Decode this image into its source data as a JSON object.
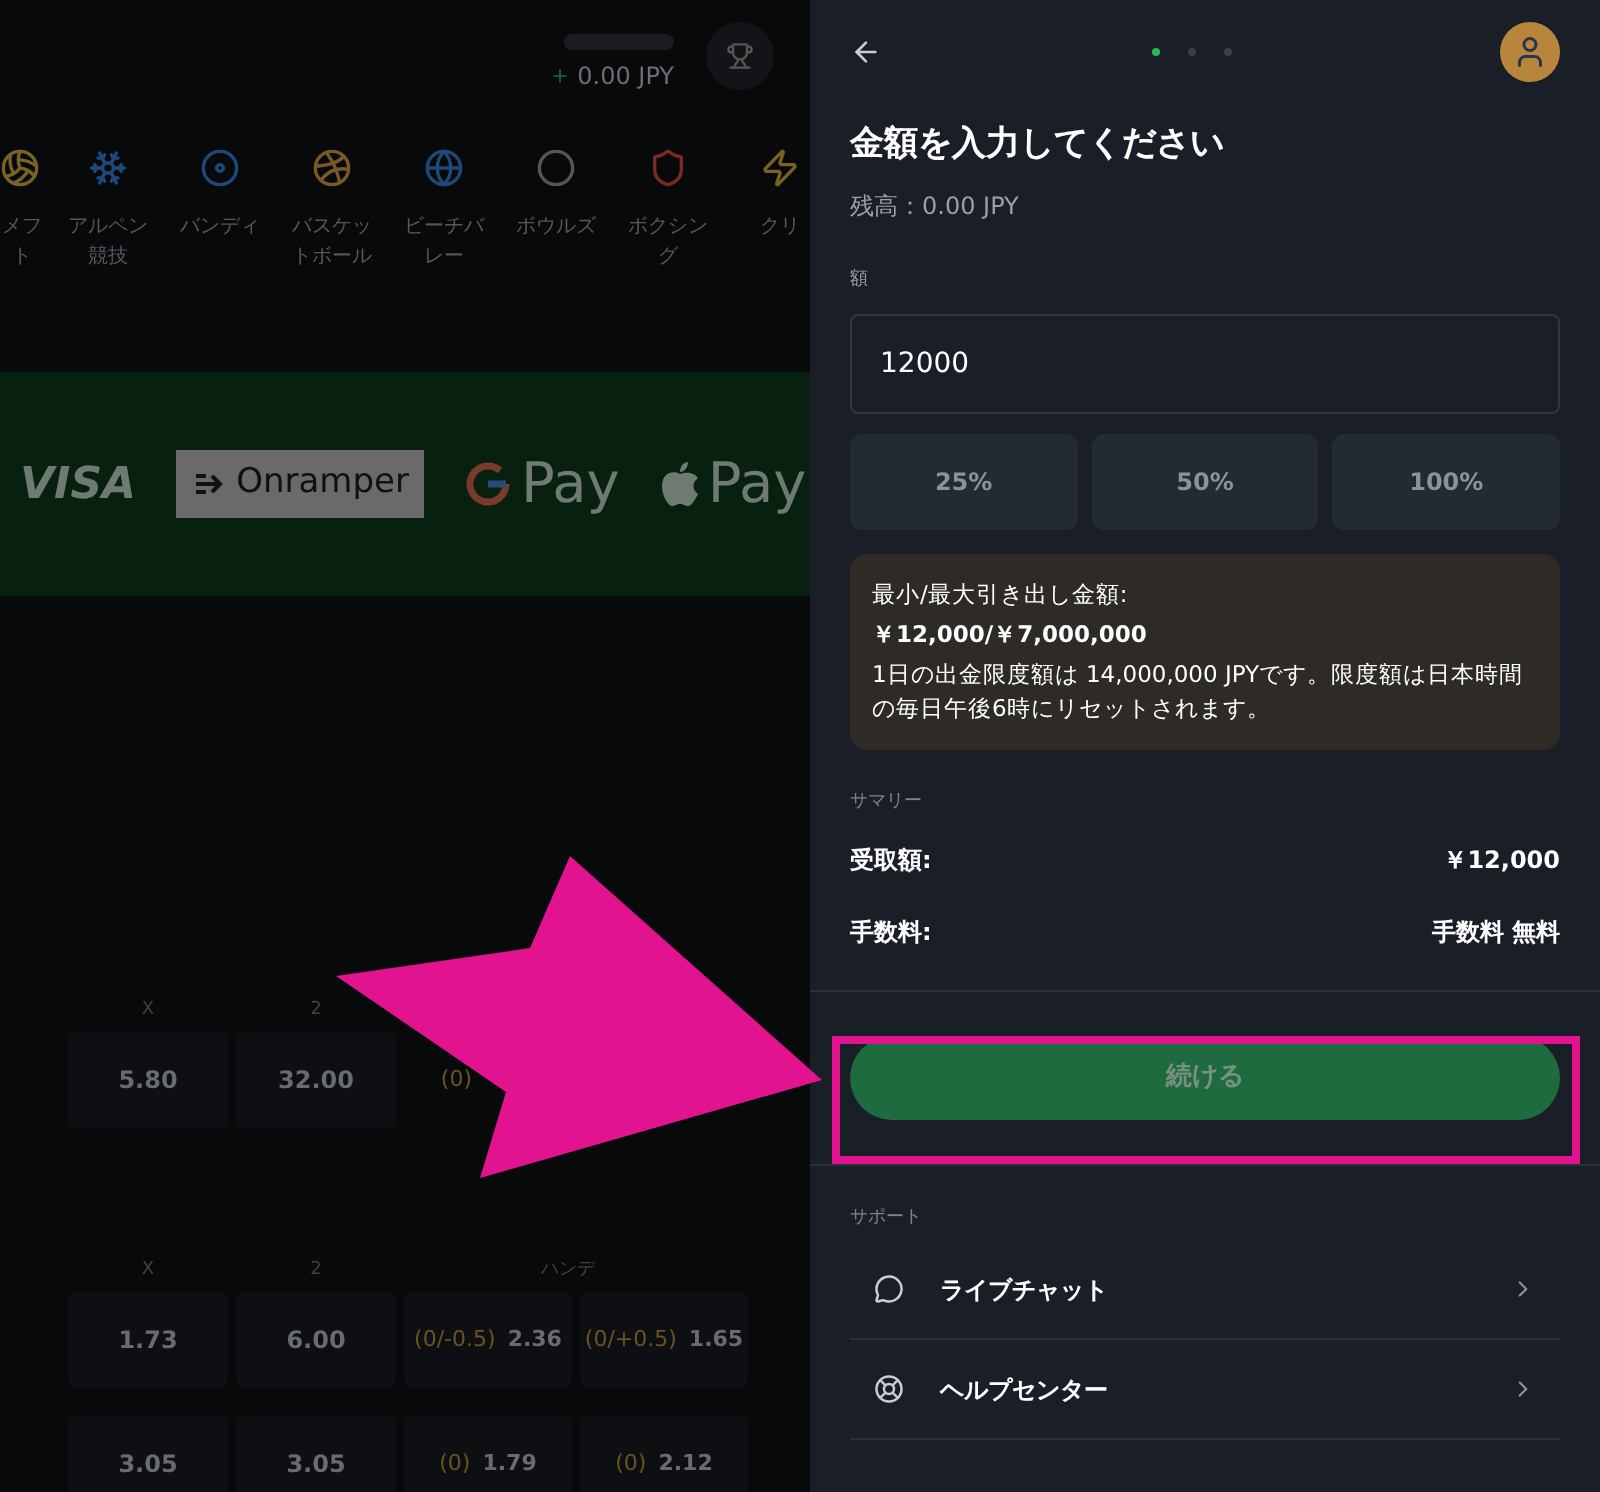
{
  "background": {
    "balance": "0.00 JPY",
    "sports": [
      "メフト",
      "アルペン競技",
      "バンディ",
      "バスケットボール",
      "ビーチバレー",
      "ボウルズ",
      "ボクシング",
      "クリ"
    ],
    "payment_logos": [
      {
        "kind": "visa",
        "text": "VISA"
      },
      {
        "kind": "onramper",
        "text": "Onramper"
      },
      {
        "kind": "gpay",
        "text": "Pay"
      },
      {
        "kind": "applepay",
        "text": "Pay"
      }
    ],
    "odds_sections": [
      {
        "headers": [
          "X",
          "2"
        ],
        "rows": [
          [
            {
              "price": "5.80"
            },
            {
              "price": "32.00"
            },
            {
              "line": "(0)"
            }
          ]
        ]
      },
      {
        "headers": [
          "X",
          "2",
          "ハンデ"
        ],
        "rows": [
          [
            {
              "price": "1.73"
            },
            {
              "price": "6.00"
            },
            {
              "line": "(0/-0.5)",
              "price": "2.36"
            },
            {
              "line": "(0/+0.5)",
              "price": "1.65"
            }
          ],
          [
            {
              "price": "3.05"
            },
            {
              "price": "3.05"
            },
            {
              "line": "(0)",
              "price": "1.79"
            },
            {
              "line": "(0)",
              "price": "2.12"
            }
          ]
        ]
      }
    ]
  },
  "panel": {
    "steps": [
      {
        "selected": true
      },
      {
        "selected": false
      },
      {
        "selected": false
      }
    ],
    "title": "金額を入力してください",
    "balance": "残高：0.00 JPY",
    "amount_label": "額",
    "amount_value": "12000",
    "presets": [
      "25%",
      "50%",
      "100%"
    ],
    "notice": {
      "heading": "最小/最大引き出し金額:",
      "range": "￥12,000/￥7,000,000",
      "body": "1日の出金限度額は 14,000,000 JPYです。限度額は日本時間の毎日午後6時にリセットされます。"
    },
    "summary_label": "サマリー",
    "summary": [
      {
        "label": "受取額:",
        "value": "￥12,000"
      },
      {
        "label": "手数料:",
        "value": "手数料 無料"
      }
    ],
    "continue_button": {
      "label": "続ける",
      "disabled": true
    },
    "support_label": "サポート",
    "support_items": [
      {
        "kind": "chat",
        "label": "ライブチャット"
      },
      {
        "kind": "help",
        "label": "ヘルプセンター"
      }
    ]
  }
}
